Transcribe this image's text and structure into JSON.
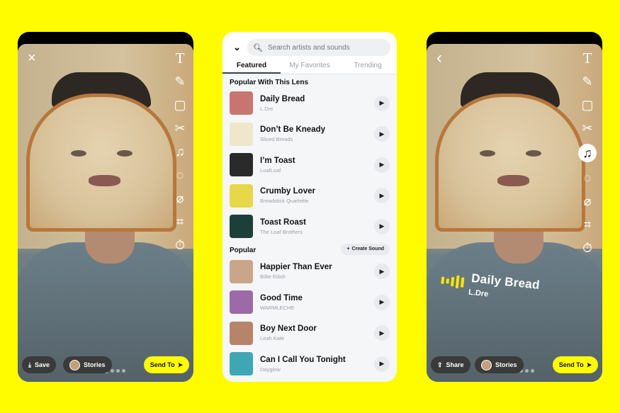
{
  "left_phone": {
    "close_icon": "×",
    "page_dots": 7,
    "active_dot": 4,
    "save_label": "Save",
    "stories_label": "Stories",
    "send_label": "Send To"
  },
  "right_phone": {
    "back_icon": "‹",
    "page_dots": 7,
    "active_dot": 4,
    "share_label": "Share",
    "stories_label": "Stories",
    "send_label": "Send To",
    "sticker": {
      "title": "Daily Bread",
      "artist": "L.Dre"
    }
  },
  "tools": [
    "text",
    "pen",
    "sticker",
    "scissors",
    "music",
    "lens",
    "paperclip",
    "crop",
    "timer"
  ],
  "panel": {
    "search_placeholder": "Search artists and sounds",
    "tabs": [
      {
        "label": "Featured",
        "active": true
      },
      {
        "label": "My Favorites",
        "active": false
      },
      {
        "label": "Trending",
        "active": false
      }
    ],
    "section1_title": "Popular With This Lens",
    "section2_title": "Popular",
    "create_sound_label": "Create Sound",
    "section1": [
      {
        "title": "Daily Bread",
        "artist": "L.Dre",
        "art": "#c9756f"
      },
      {
        "title": "Don’t Be Kneady",
        "artist": "Sliced Breads",
        "art": "#efe6cc"
      },
      {
        "title": "I’m Toast",
        "artist": "LoafLoaf",
        "art": "#2a2a2a"
      },
      {
        "title": "Crumby Lover",
        "artist": "Breadstick Quartette",
        "art": "#e7d84a"
      },
      {
        "title": "Toast Roast",
        "artist": "The Loaf Brothers",
        "art": "#1d3f3a"
      }
    ],
    "section2": [
      {
        "title": "Happier Than Ever",
        "artist": "Billie Eilish",
        "art": "#c9a58a"
      },
      {
        "title": "Good Time",
        "artist": "WARMLECHE",
        "art": "#9c6aa8"
      },
      {
        "title": "Boy Next Door",
        "artist": "Leah Kate",
        "art": "#b68468"
      },
      {
        "title": "Can I Call You Tonight",
        "artist": "Dayglow",
        "art": "#3fa7b4"
      }
    ]
  }
}
